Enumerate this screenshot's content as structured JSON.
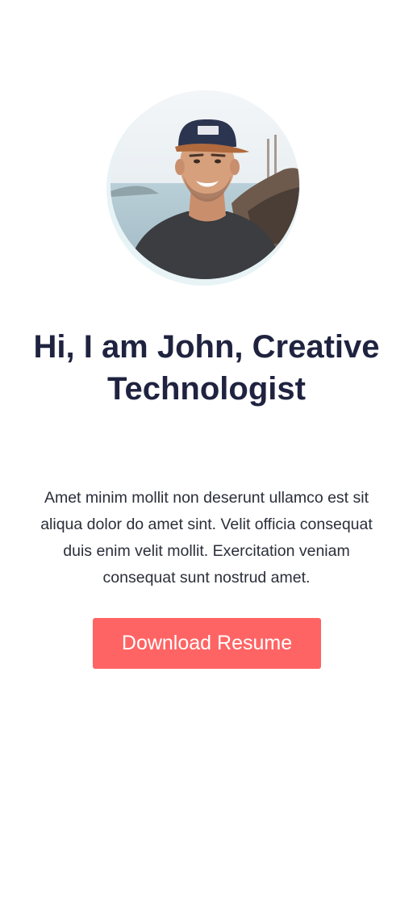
{
  "hero": {
    "avatar_icon": "portrait-photo",
    "headline": "Hi, I am John, Creative Technologist",
    "bio": "Amet minim mollit non deserunt ullamco est sit aliqua dolor do amet sint. Velit officia consequat duis enim velit mollit. Exercitation veniam consequat sunt nostrud amet.",
    "button_label": "Download Resume"
  },
  "colors": {
    "accent": "#ff6464",
    "heading": "#1f2340",
    "body_text": "#2b2e3a",
    "avatar_ring": "#e8f3f6"
  }
}
